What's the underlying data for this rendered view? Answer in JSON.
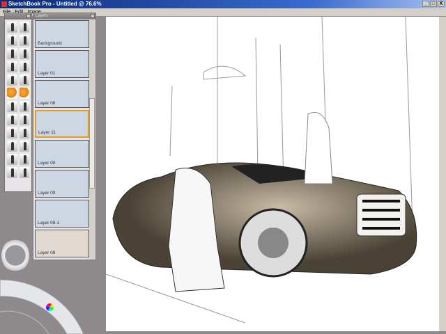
{
  "window": {
    "title": "SketchBook Pro - Untitled @ 76.6%",
    "minimize": "_",
    "maximize": "□",
    "close": "X"
  },
  "menu": [
    "File",
    "Edit",
    "Image"
  ],
  "tools_panel": {
    "title": ""
  },
  "layers_panel": {
    "title": "Layers",
    "selected": "Layer 11",
    "layers": [
      "Background",
      "Layer 01",
      "Layer 08",
      "Layer 11",
      "Layer 09",
      "Layer 09",
      "Layer 08-1",
      "Layer 08"
    ]
  },
  "colors": {
    "accent": "#e89a20",
    "layer_bg": "#cdd6e3"
  }
}
